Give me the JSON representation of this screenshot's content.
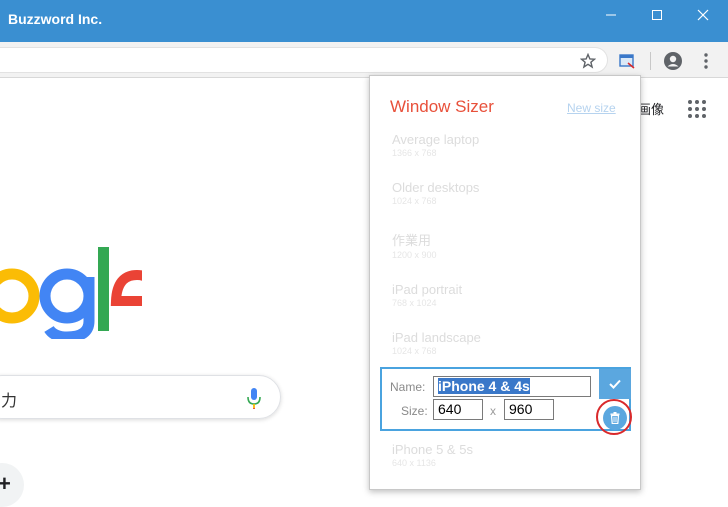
{
  "window": {
    "title": "Buzzword Inc."
  },
  "google": {
    "logo_partial": "ogle",
    "search_partial": "力",
    "images_link": "画像",
    "plus_symbol": "+"
  },
  "popup": {
    "title": "Window Sizer",
    "new_size_link": "New size",
    "presets_before": [
      {
        "name": "Average laptop",
        "size": "1366 x 768"
      },
      {
        "name": "Older desktops",
        "size": "1024 x 768"
      },
      {
        "name": "作業用",
        "size": "1200 x 900"
      },
      {
        "name": "iPad portrait",
        "size": "768 x 1024"
      },
      {
        "name": "iPad landscape",
        "size": "1024 x 768"
      }
    ],
    "edit": {
      "name_label": "Name:",
      "name_value": "iPhone 4 & 4s",
      "size_label": "Size:",
      "width_value": "640",
      "height_value": "960",
      "separator": "x"
    },
    "presets_after": [
      {
        "name": "iPhone 5 & 5s",
        "size": "640 x 1136"
      }
    ]
  },
  "colors": {
    "titlebar": "#3a8fd1",
    "popup_title": "#e8503a",
    "accent_button": "#5ba7df",
    "highlight_circle": "#d9292b"
  }
}
